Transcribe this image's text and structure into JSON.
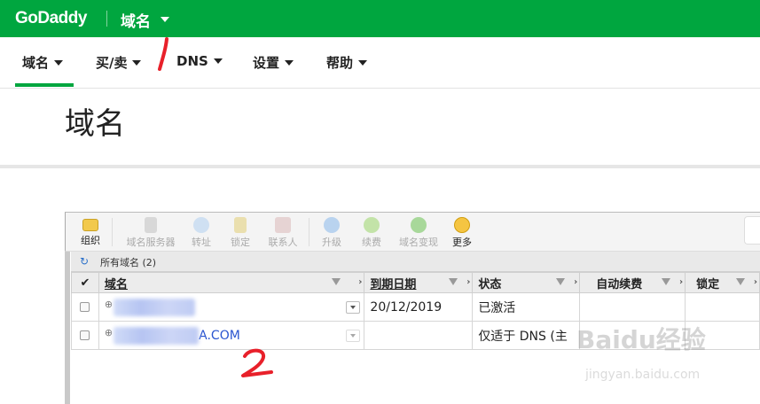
{
  "header": {
    "logo": "GoDaddy",
    "section": "域名"
  },
  "nav": {
    "items": [
      {
        "label": "域名"
      },
      {
        "label": "买/卖"
      },
      {
        "label": "DNS"
      },
      {
        "label": "设置"
      },
      {
        "label": "帮助"
      }
    ]
  },
  "page": {
    "title": "域名"
  },
  "toolbar": {
    "buttons": [
      {
        "label": "组织",
        "icon": "folder-icon"
      },
      {
        "label": "域名服务器",
        "icon": "server-icon"
      },
      {
        "label": "转址",
        "icon": "forward-icon"
      },
      {
        "label": "锁定",
        "icon": "lock-icon"
      },
      {
        "label": "联系人",
        "icon": "contact-icon"
      },
      {
        "label": "升级",
        "icon": "upgrade-icon"
      },
      {
        "label": "续费",
        "icon": "renew-icon"
      },
      {
        "label": "域名变现",
        "icon": "dollar-icon"
      },
      {
        "label": "更多",
        "icon": "more-icon"
      }
    ]
  },
  "subbar": {
    "label": "所有域名 (2)"
  },
  "grid": {
    "columns": [
      "域名",
      "到期日期",
      "状态",
      "自动续费",
      "锁定"
    ],
    "rows": [
      {
        "domain": "",
        "expiry": "20/12/2019",
        "status": "已激活",
        "autorenew": "",
        "lock": ""
      },
      {
        "domain": "A.COM",
        "expiry": "",
        "status": "仅适于 DNS (主",
        "autorenew": "",
        "lock": ""
      }
    ]
  },
  "annotations": {
    "one": "1",
    "two": "2"
  },
  "watermark": {
    "brand": "Baidu经验",
    "url": "jingyan.baidu.com"
  },
  "colors": {
    "brand_green": "#00a63f",
    "link": "#2a55d0",
    "annotation_red": "#e8202a"
  }
}
